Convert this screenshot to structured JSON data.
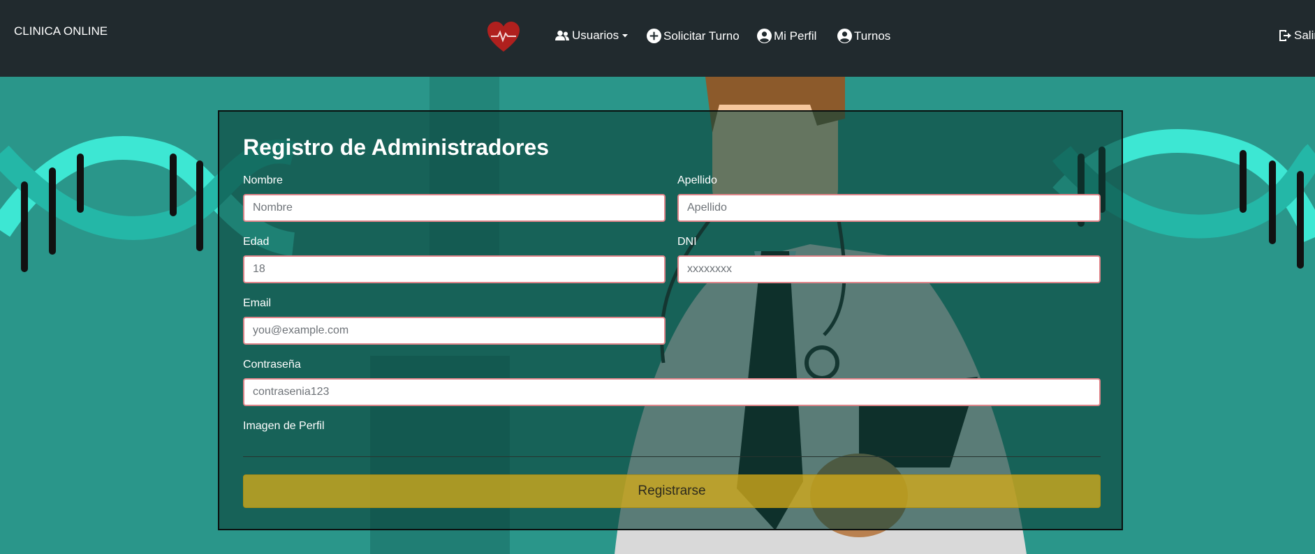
{
  "nav": {
    "brand": "CLINICA ONLINE",
    "logo_icon": "heart-pulse-icon",
    "items": [
      {
        "label": "Usuarios",
        "icon": "users-icon",
        "dropdown": true
      },
      {
        "label": "Solicitar Turno",
        "icon": "plus-circle-icon"
      },
      {
        "label": "Mi Perfil",
        "icon": "user-circle-icon"
      },
      {
        "label": "Turnos",
        "icon": "user-circle-icon"
      }
    ],
    "logout": {
      "label": "Salir",
      "icon": "logout-icon"
    }
  },
  "form": {
    "title": "Registro de Administradores",
    "fields": {
      "nombre": {
        "label": "Nombre",
        "placeholder": "Nombre",
        "value": ""
      },
      "apellido": {
        "label": "Apellido",
        "placeholder": "Apellido",
        "value": ""
      },
      "edad": {
        "label": "Edad",
        "placeholder": "18",
        "value": ""
      },
      "dni": {
        "label": "DNI",
        "placeholder": "xxxxxxxx",
        "value": ""
      },
      "email": {
        "label": "Email",
        "placeholder": "you@example.com",
        "value": ""
      },
      "password": {
        "label": "Contraseña",
        "placeholder": "contrasenia123",
        "value": ""
      },
      "imagen": {
        "label": "Imagen de Perfil"
      }
    },
    "submit_label": "Registrarse"
  },
  "colors": {
    "navbar_bg": "#212a2e",
    "page_bg": "#2a968a",
    "field_border": "#e0858a",
    "submit_bg": "#d4aa19",
    "heart": "#b0201e"
  }
}
